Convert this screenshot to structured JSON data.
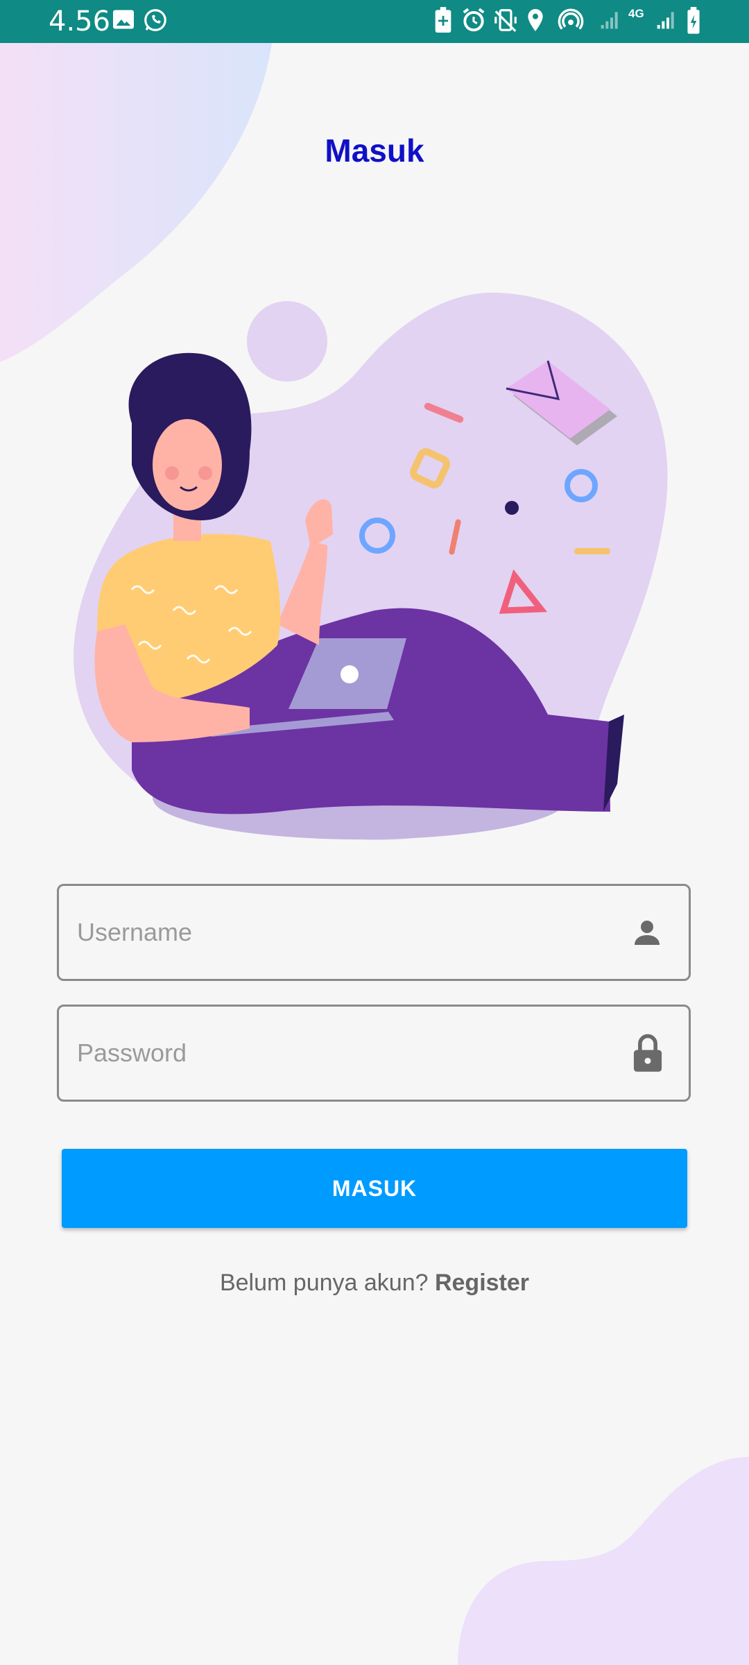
{
  "status_bar": {
    "time": "4.56",
    "icons": [
      "image-icon",
      "whatsapp-icon",
      "battery-saver-icon",
      "alarm-icon",
      "vibrate-off-icon",
      "location-icon",
      "hotspot-icon",
      "signal-icon",
      "4g-icon",
      "signal-icon",
      "battery-charging-icon"
    ],
    "network_label": "4G"
  },
  "login": {
    "title": "Masuk",
    "username_placeholder": "Username",
    "password_placeholder": "Password",
    "submit_label": "MASUK",
    "no_account_text": "Belum punya akun?",
    "register_link": "Register"
  },
  "colors": {
    "status_bar": "#0f8a84",
    "title": "#1010c8",
    "button": "#009bff",
    "background": "#f6f6f6",
    "blob": "#e2d3f2"
  }
}
